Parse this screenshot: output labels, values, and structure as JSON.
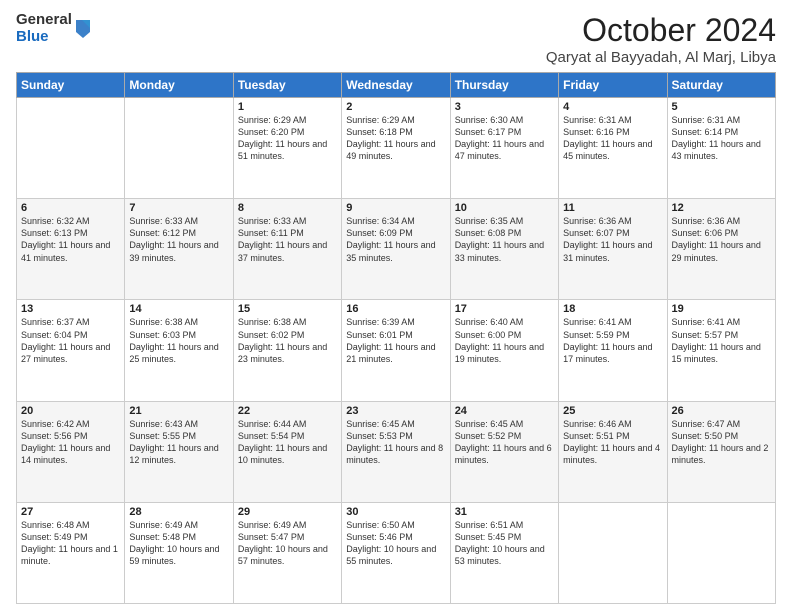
{
  "logo": {
    "general": "General",
    "blue": "Blue"
  },
  "header": {
    "month": "October 2024",
    "location": "Qaryat al Bayyadah, Al Marj, Libya"
  },
  "weekdays": [
    "Sunday",
    "Monday",
    "Tuesday",
    "Wednesday",
    "Thursday",
    "Friday",
    "Saturday"
  ],
  "weeks": [
    [
      {
        "day": "",
        "info": ""
      },
      {
        "day": "",
        "info": ""
      },
      {
        "day": "1",
        "info": "Sunrise: 6:29 AM\nSunset: 6:20 PM\nDaylight: 11 hours and 51 minutes."
      },
      {
        "day": "2",
        "info": "Sunrise: 6:29 AM\nSunset: 6:18 PM\nDaylight: 11 hours and 49 minutes."
      },
      {
        "day": "3",
        "info": "Sunrise: 6:30 AM\nSunset: 6:17 PM\nDaylight: 11 hours and 47 minutes."
      },
      {
        "day": "4",
        "info": "Sunrise: 6:31 AM\nSunset: 6:16 PM\nDaylight: 11 hours and 45 minutes."
      },
      {
        "day": "5",
        "info": "Sunrise: 6:31 AM\nSunset: 6:14 PM\nDaylight: 11 hours and 43 minutes."
      }
    ],
    [
      {
        "day": "6",
        "info": "Sunrise: 6:32 AM\nSunset: 6:13 PM\nDaylight: 11 hours and 41 minutes."
      },
      {
        "day": "7",
        "info": "Sunrise: 6:33 AM\nSunset: 6:12 PM\nDaylight: 11 hours and 39 minutes."
      },
      {
        "day": "8",
        "info": "Sunrise: 6:33 AM\nSunset: 6:11 PM\nDaylight: 11 hours and 37 minutes."
      },
      {
        "day": "9",
        "info": "Sunrise: 6:34 AM\nSunset: 6:09 PM\nDaylight: 11 hours and 35 minutes."
      },
      {
        "day": "10",
        "info": "Sunrise: 6:35 AM\nSunset: 6:08 PM\nDaylight: 11 hours and 33 minutes."
      },
      {
        "day": "11",
        "info": "Sunrise: 6:36 AM\nSunset: 6:07 PM\nDaylight: 11 hours and 31 minutes."
      },
      {
        "day": "12",
        "info": "Sunrise: 6:36 AM\nSunset: 6:06 PM\nDaylight: 11 hours and 29 minutes."
      }
    ],
    [
      {
        "day": "13",
        "info": "Sunrise: 6:37 AM\nSunset: 6:04 PM\nDaylight: 11 hours and 27 minutes."
      },
      {
        "day": "14",
        "info": "Sunrise: 6:38 AM\nSunset: 6:03 PM\nDaylight: 11 hours and 25 minutes."
      },
      {
        "day": "15",
        "info": "Sunrise: 6:38 AM\nSunset: 6:02 PM\nDaylight: 11 hours and 23 minutes."
      },
      {
        "day": "16",
        "info": "Sunrise: 6:39 AM\nSunset: 6:01 PM\nDaylight: 11 hours and 21 minutes."
      },
      {
        "day": "17",
        "info": "Sunrise: 6:40 AM\nSunset: 6:00 PM\nDaylight: 11 hours and 19 minutes."
      },
      {
        "day": "18",
        "info": "Sunrise: 6:41 AM\nSunset: 5:59 PM\nDaylight: 11 hours and 17 minutes."
      },
      {
        "day": "19",
        "info": "Sunrise: 6:41 AM\nSunset: 5:57 PM\nDaylight: 11 hours and 15 minutes."
      }
    ],
    [
      {
        "day": "20",
        "info": "Sunrise: 6:42 AM\nSunset: 5:56 PM\nDaylight: 11 hours and 14 minutes."
      },
      {
        "day": "21",
        "info": "Sunrise: 6:43 AM\nSunset: 5:55 PM\nDaylight: 11 hours and 12 minutes."
      },
      {
        "day": "22",
        "info": "Sunrise: 6:44 AM\nSunset: 5:54 PM\nDaylight: 11 hours and 10 minutes."
      },
      {
        "day": "23",
        "info": "Sunrise: 6:45 AM\nSunset: 5:53 PM\nDaylight: 11 hours and 8 minutes."
      },
      {
        "day": "24",
        "info": "Sunrise: 6:45 AM\nSunset: 5:52 PM\nDaylight: 11 hours and 6 minutes."
      },
      {
        "day": "25",
        "info": "Sunrise: 6:46 AM\nSunset: 5:51 PM\nDaylight: 11 hours and 4 minutes."
      },
      {
        "day": "26",
        "info": "Sunrise: 6:47 AM\nSunset: 5:50 PM\nDaylight: 11 hours and 2 minutes."
      }
    ],
    [
      {
        "day": "27",
        "info": "Sunrise: 6:48 AM\nSunset: 5:49 PM\nDaylight: 11 hours and 1 minute."
      },
      {
        "day": "28",
        "info": "Sunrise: 6:49 AM\nSunset: 5:48 PM\nDaylight: 10 hours and 59 minutes."
      },
      {
        "day": "29",
        "info": "Sunrise: 6:49 AM\nSunset: 5:47 PM\nDaylight: 10 hours and 57 minutes."
      },
      {
        "day": "30",
        "info": "Sunrise: 6:50 AM\nSunset: 5:46 PM\nDaylight: 10 hours and 55 minutes."
      },
      {
        "day": "31",
        "info": "Sunrise: 6:51 AM\nSunset: 5:45 PM\nDaylight: 10 hours and 53 minutes."
      },
      {
        "day": "",
        "info": ""
      },
      {
        "day": "",
        "info": ""
      }
    ]
  ]
}
